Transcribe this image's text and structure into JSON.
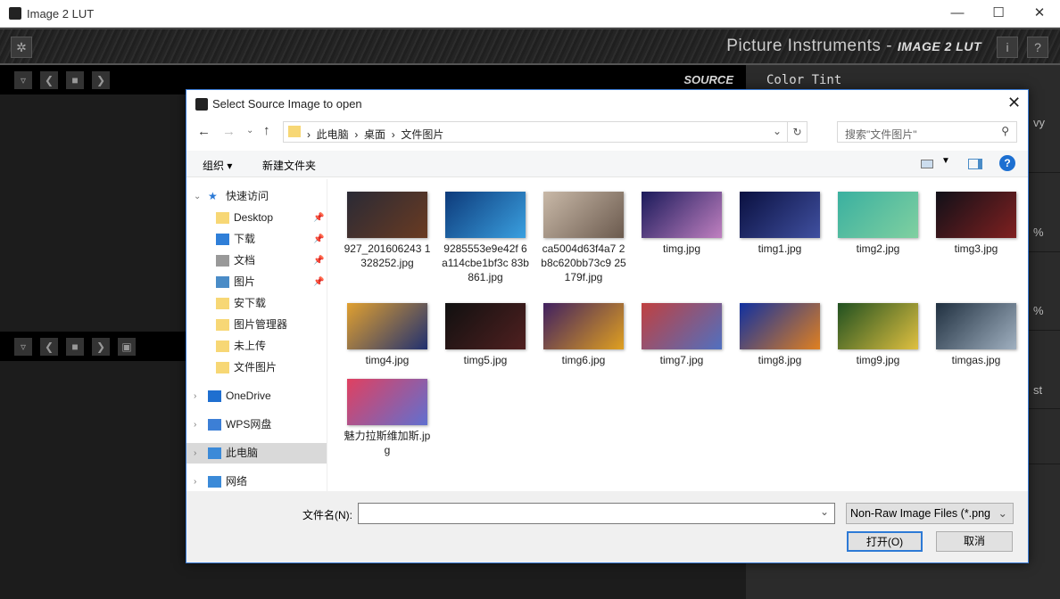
{
  "window": {
    "title": "Image 2 LUT",
    "controls": [
      "—",
      "☐",
      "✕"
    ]
  },
  "app_header": {
    "settings_icon": "gear-icon",
    "brand": "Picture Instruments - ",
    "product": "IMAGE 2 LUT",
    "info_label": "i",
    "help_label": "?"
  },
  "source_panel": {
    "label": "SOURCE"
  },
  "right_panel": {
    "title": "Color Tint",
    "fragments": [
      "vy",
      "%",
      "%",
      "st"
    ]
  },
  "dialog": {
    "title": "Select Source Image to open",
    "breadcrumb": [
      "此电脑",
      "桌面",
      "文件图片"
    ],
    "search_placeholder": "搜索\"文件图片\"",
    "organize": "组织 ▾",
    "new_folder": "新建文件夹",
    "nav": [
      {
        "label": "快速访问",
        "icon": "star-icon",
        "color": "#2b79d6"
      },
      {
        "label": "Desktop",
        "icon": "folder-icon",
        "color": "#f7d775",
        "pinned": true
      },
      {
        "label": "下载",
        "icon": "download-icon",
        "color": "#2f7fd8",
        "pinned": true
      },
      {
        "label": "文档",
        "icon": "document-icon",
        "color": "#999",
        "pinned": true
      },
      {
        "label": "图片",
        "icon": "pictures-icon",
        "color": "#4a8cc7",
        "pinned": true
      },
      {
        "label": "安下载",
        "icon": "folder-icon",
        "color": "#f7d775"
      },
      {
        "label": "图片管理器",
        "icon": "folder-icon",
        "color": "#f7d775"
      },
      {
        "label": "未上传",
        "icon": "folder-icon",
        "color": "#f7d775"
      },
      {
        "label": "文件图片",
        "icon": "folder-icon",
        "color": "#f7d775"
      },
      {
        "label": "OneDrive",
        "icon": "cloud-icon",
        "color": "#1f6fd0"
      },
      {
        "label": "WPS网盘",
        "icon": "cloud-icon",
        "color": "#3c7fd6"
      },
      {
        "label": "此电脑",
        "icon": "computer-icon",
        "color": "#3b8ad8",
        "selected": true
      },
      {
        "label": "网络",
        "icon": "network-icon",
        "color": "#3b8ad8"
      }
    ],
    "files": [
      {
        "name": "927_201606243 1328252.jpg",
        "colors": [
          "#2a2a35",
          "#6a3b22"
        ]
      },
      {
        "name": "9285553e9e42f 6a114cbe1bf3c 83b861.jpg",
        "colors": [
          "#0d3a7a",
          "#3aa0e0"
        ]
      },
      {
        "name": "ca5004d63f4a7 2b8c620bb73c9 25179f.jpg",
        "colors": [
          "#c9b9a8",
          "#6b5a4e"
        ]
      },
      {
        "name": "timg.jpg",
        "colors": [
          "#1a1a5a",
          "#c080c0"
        ]
      },
      {
        "name": "timg1.jpg",
        "colors": [
          "#0a1040",
          "#4050a0"
        ]
      },
      {
        "name": "timg2.jpg",
        "colors": [
          "#3ab0a0",
          "#80d0a0"
        ]
      },
      {
        "name": "timg3.jpg",
        "colors": [
          "#101018",
          "#802020"
        ]
      },
      {
        "name": "timg4.jpg",
        "colors": [
          "#e0a030",
          "#203070"
        ]
      },
      {
        "name": "timg5.jpg",
        "colors": [
          "#101010",
          "#502020"
        ]
      },
      {
        "name": "timg6.jpg",
        "colors": [
          "#402060",
          "#e0a020"
        ]
      },
      {
        "name": "timg7.jpg",
        "colors": [
          "#c04040",
          "#5070c0"
        ]
      },
      {
        "name": "timg8.jpg",
        "colors": [
          "#1030a0",
          "#e08020"
        ]
      },
      {
        "name": "timg9.jpg",
        "colors": [
          "#205020",
          "#e0c040"
        ]
      },
      {
        "name": "timgas.jpg",
        "colors": [
          "#203040",
          "#a0b0c0"
        ]
      },
      {
        "name": "魅力拉斯维加斯.jpg",
        "colors": [
          "#e04060",
          "#6070d0"
        ]
      }
    ],
    "filename_label": "文件名(N):",
    "filename_value": "",
    "filetype": "Non-Raw Image Files (*.png",
    "open": "打开(O)",
    "cancel": "取消"
  }
}
